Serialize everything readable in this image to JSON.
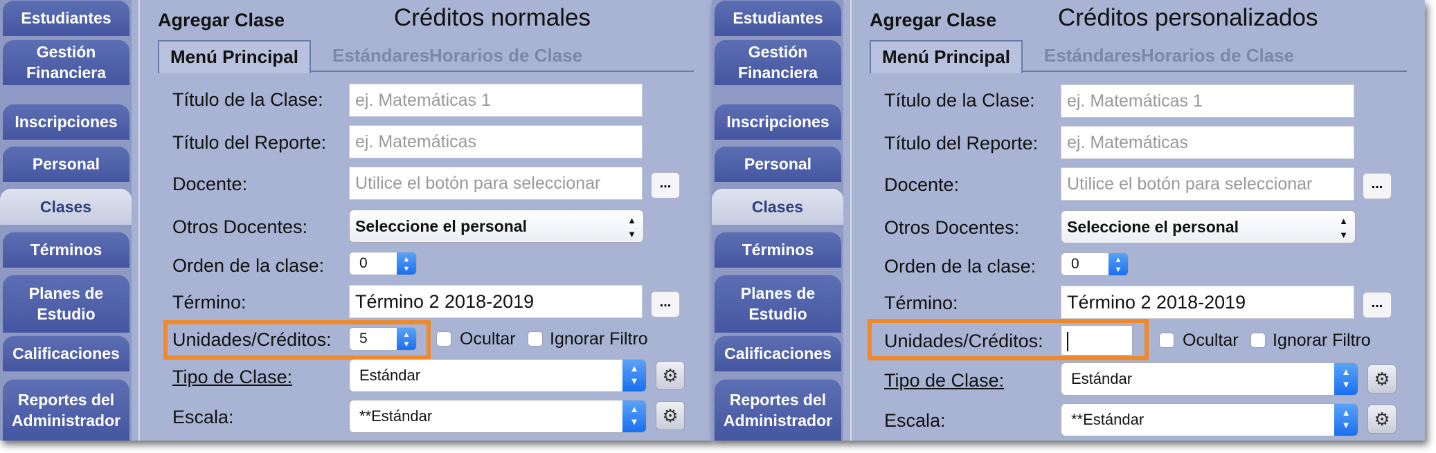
{
  "sidebar": {
    "items": [
      {
        "label": "Estudiantes"
      },
      {
        "label": "Gestión Financiera"
      },
      {
        "label": "Inscripciones"
      },
      {
        "label": "Personal"
      },
      {
        "label": "Clases"
      },
      {
        "label": "Términos"
      },
      {
        "label": "Planes de Estudio"
      },
      {
        "label": "Calificaciones"
      },
      {
        "label": "Reportes del Administrador"
      }
    ],
    "active": "Clases"
  },
  "panels": [
    {
      "caption": "Créditos normales",
      "units_value": "5"
    },
    {
      "caption": "Créditos personalizados",
      "units_value": ""
    }
  ],
  "form": {
    "panel_title": "Agregar Clase",
    "tabs": [
      "Menú Principal",
      "Estándares",
      "Horarios de Clase"
    ],
    "class_title_label": "Título de la Clase:",
    "class_title_placeholder": "ej. Matemáticas 1",
    "report_title_label": "Título del Reporte:",
    "report_title_placeholder": "ej. Matemáticas",
    "teacher_label": "Docente:",
    "teacher_placeholder": "Utilice el botón para seleccionar",
    "dots": "...",
    "other_teachers_label": "Otros Docentes:",
    "other_teachers_value": "Seleccione el personal",
    "class_order_label": "Orden de la clase:",
    "class_order_value": "0",
    "term_label": "Término:",
    "term_value": "Término 2 2018-2019",
    "units_label": "Unidades/Créditos:",
    "hide_label": "Ocultar",
    "ignore_filter_label": "Ignorar Filtro",
    "class_type_label": "Tipo de Clase:",
    "class_type_value": "Estándar",
    "scale_label": "Escala:",
    "scale_value": "**Estándar"
  },
  "colors": {
    "highlight": "#f0892a",
    "sidebar_button": "#4a5aa6",
    "panel_bg": "#a9b4d4"
  }
}
